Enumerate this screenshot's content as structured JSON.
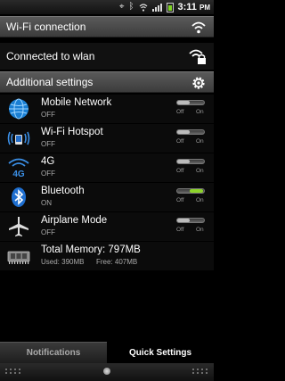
{
  "status_bar": {
    "time": "3:11",
    "time_suffix": "PM",
    "icons": [
      "gps-icon",
      "bluetooth-icon",
      "wifi-icon",
      "signal-icon",
      "battery-icon"
    ]
  },
  "wifi_section": {
    "title": "Wi-Fi connection",
    "icon": "wifi-icon"
  },
  "wlan": {
    "label": "Connected to wlan",
    "icon": "wifi-lock-icon"
  },
  "additional_section": {
    "title": "Additional settings",
    "icon": "gear-icon"
  },
  "settings": [
    {
      "label": "Mobile Network",
      "state": "OFF",
      "icon": "globe-icon",
      "on": false,
      "toggle_off": "Off",
      "toggle_on": "On"
    },
    {
      "label": "Wi-Fi Hotspot",
      "state": "OFF",
      "icon": "hotspot-icon",
      "on": false,
      "toggle_off": "Off",
      "toggle_on": "On"
    },
    {
      "label": "4G",
      "state": "OFF",
      "icon": "4g-icon",
      "on": false,
      "toggle_off": "Off",
      "toggle_on": "On"
    },
    {
      "label": "Bluetooth",
      "state": "ON",
      "icon": "bluetooth-icon",
      "on": true,
      "toggle_off": "Off",
      "toggle_on": "On"
    },
    {
      "label": "Airplane Mode",
      "state": "OFF",
      "icon": "airplane-icon",
      "on": false,
      "toggle_off": "Off",
      "toggle_on": "On"
    }
  ],
  "memory": {
    "label": "Total Memory: 797MB",
    "used": "Used: 390MB",
    "free": "Free: 407MB",
    "icon": "memory-chip-icon"
  },
  "tabs": [
    {
      "label": "Notifications",
      "active": false
    },
    {
      "label": "Quick Settings",
      "active": true
    }
  ],
  "colors": {
    "toggle_on": "#8cd32a",
    "battery": "#7ed321",
    "header": "#4a4a4a"
  }
}
